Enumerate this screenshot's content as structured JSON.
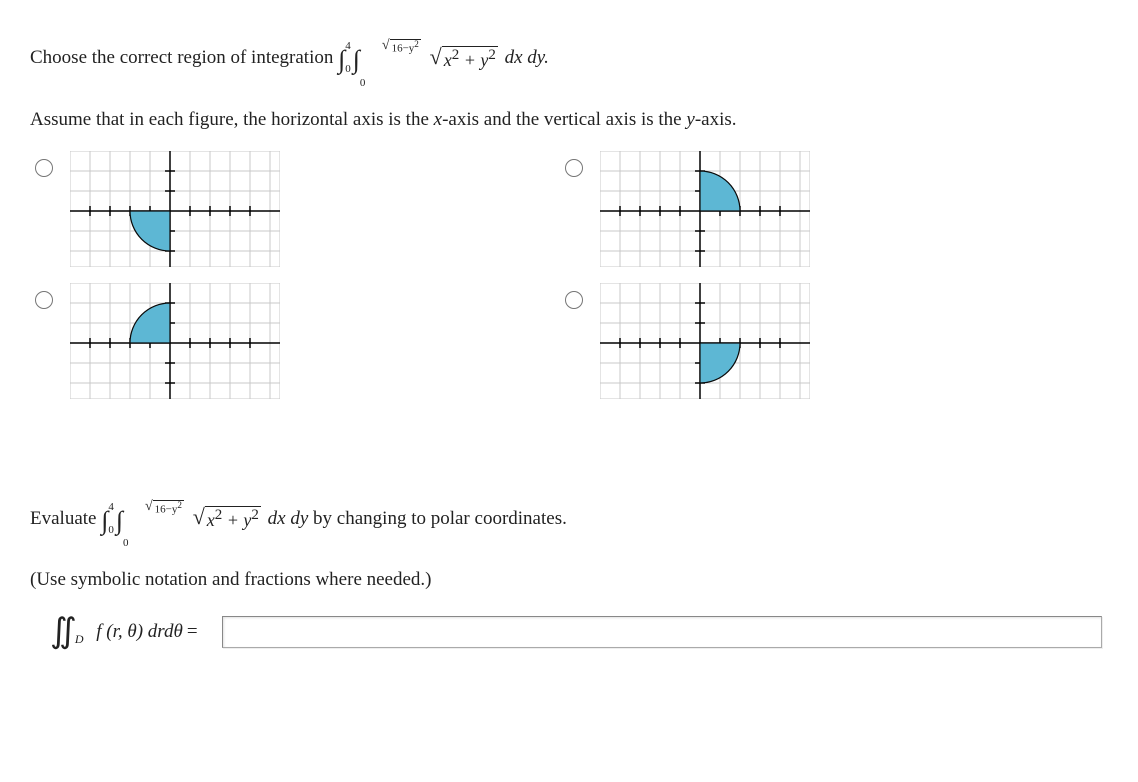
{
  "q1": {
    "prefix": "Choose the correct region of integration ",
    "int1_lo": "0",
    "int1_hi": "4",
    "int2_lo": "0",
    "int2_hi_sqrt": "16−y",
    "int2_hi_sup": "2",
    "integrand_sqrt": "x",
    "integrand_sup1": "2",
    "integrand_plus": " + y",
    "integrand_sup2": "2",
    "diff": " dx dy.",
    "note": "Assume that in each figure, the horizontal axis is the ",
    "x_axis": "x",
    "note_mid": "-axis and the vertical axis is the ",
    "y_axis": "y",
    "note_end": "-axis."
  },
  "choices": [
    {
      "id": "A",
      "arc_quadrant": "Q2_below"
    },
    {
      "id": "B",
      "arc_quadrant": "Q1_above"
    },
    {
      "id": "C",
      "arc_quadrant": "Q2_above"
    },
    {
      "id": "D",
      "arc_quadrant": "Q4_below"
    }
  ],
  "q2": {
    "prefix": "Evaluate ",
    "int1_lo": "0",
    "int1_hi": "4",
    "int2_lo": "0",
    "int2_hi_sqrt": "16−y",
    "int2_hi_sup": "2",
    "integrand_sqrt": "x",
    "integrand_sup1": "2",
    "integrand_plus": " + y",
    "integrand_sup2": "2",
    "diff": " dx dy",
    "suffix": " by changing to polar coordinates.",
    "hint": "(Use symbolic notation and fractions where needed.)"
  },
  "answer": {
    "lhs_sub": "D",
    "lhs_f": "f (r, θ) drdθ",
    "equals": " = ",
    "value": "",
    "placeholder": ""
  },
  "colors": {
    "grid": "#c9c9c9",
    "axis": "#000000",
    "fill": "#5db7d4",
    "fill_stroke": "#0a0a0a"
  },
  "chart_data": [
    {
      "type": "area",
      "title": "",
      "xlabel": "",
      "ylabel": "",
      "xlim": [
        -5,
        5
      ],
      "ylim": [
        -3,
        3
      ],
      "region": "quarter-disk radius 2, center (0,0), quadrant: x≤0, y≤0 shown above negative x-axis style (Q2 shape pointing down-left)"
    },
    {
      "type": "area",
      "title": "",
      "xlabel": "",
      "ylabel": "",
      "xlim": [
        -5,
        5
      ],
      "ylim": [
        -3,
        3
      ],
      "region": "quarter-disk radius 2, center (0,0), quadrant Q1 (x≥0, y≥0)"
    },
    {
      "type": "area",
      "title": "",
      "xlabel": "",
      "ylabel": "",
      "xlim": [
        -5,
        5
      ],
      "ylim": [
        -3,
        3
      ],
      "region": "quarter-disk radius 2, center (0,0), quadrant Q2 (x≤0, y≥0)"
    },
    {
      "type": "area",
      "title": "",
      "xlabel": "",
      "ylabel": "",
      "xlim": [
        -5,
        5
      ],
      "ylim": [
        -3,
        3
      ],
      "region": "quarter-disk radius 2, center (0,0), quadrant Q4 (x≥0, y≤0) shown as x≤0 below axis style"
    }
  ]
}
